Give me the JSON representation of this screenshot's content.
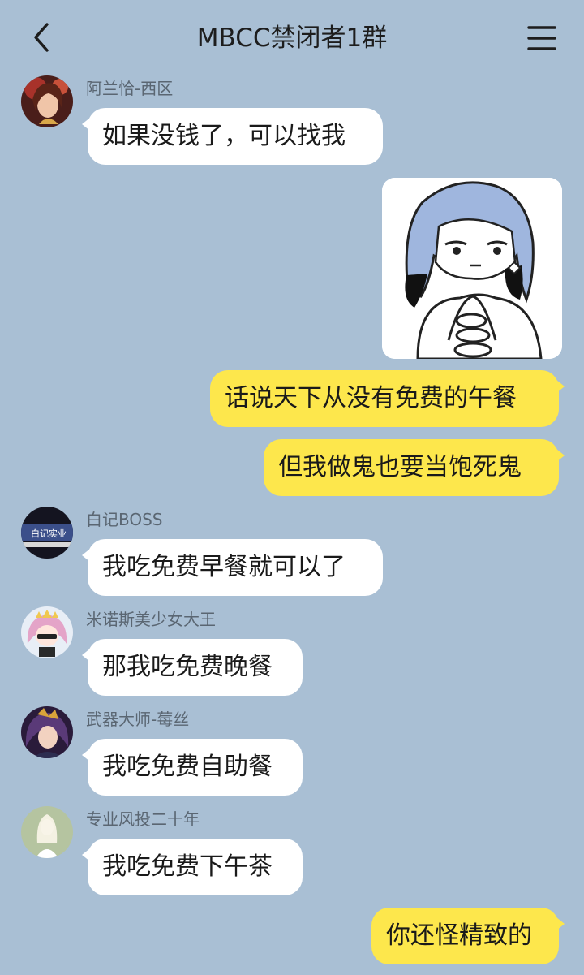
{
  "header": {
    "title": "MBCC禁闭者1群",
    "back_icon": "chevron-left-icon",
    "menu_icon": "hamburger-menu-icon"
  },
  "colors": {
    "background": "#a9bfd4",
    "incoming_bubble": "#ffffff",
    "outgoing_bubble": "#fde74c"
  },
  "messages": [
    {
      "sender": "阿兰恰-西区",
      "text": "如果没钱了，可以找我"
    },
    {
      "type": "sticker",
      "description_icon": "anime-girl-sticker"
    },
    {
      "text": "话说天下从没有免费的午餐"
    },
    {
      "text": "但我做鬼也要当饱死鬼"
    },
    {
      "sender": "白记BOSS",
      "text": "我吃免费早餐就可以了",
      "avatar_text": "白记实业"
    },
    {
      "sender": "米诺斯美少女大王",
      "text": "那我吃免费晚餐"
    },
    {
      "sender": "武器大师-莓丝",
      "text": "我吃免费自助餐"
    },
    {
      "sender": "专业风投二十年",
      "text": "我吃免费下午茶"
    },
    {
      "text": "你还怪精致的"
    }
  ]
}
